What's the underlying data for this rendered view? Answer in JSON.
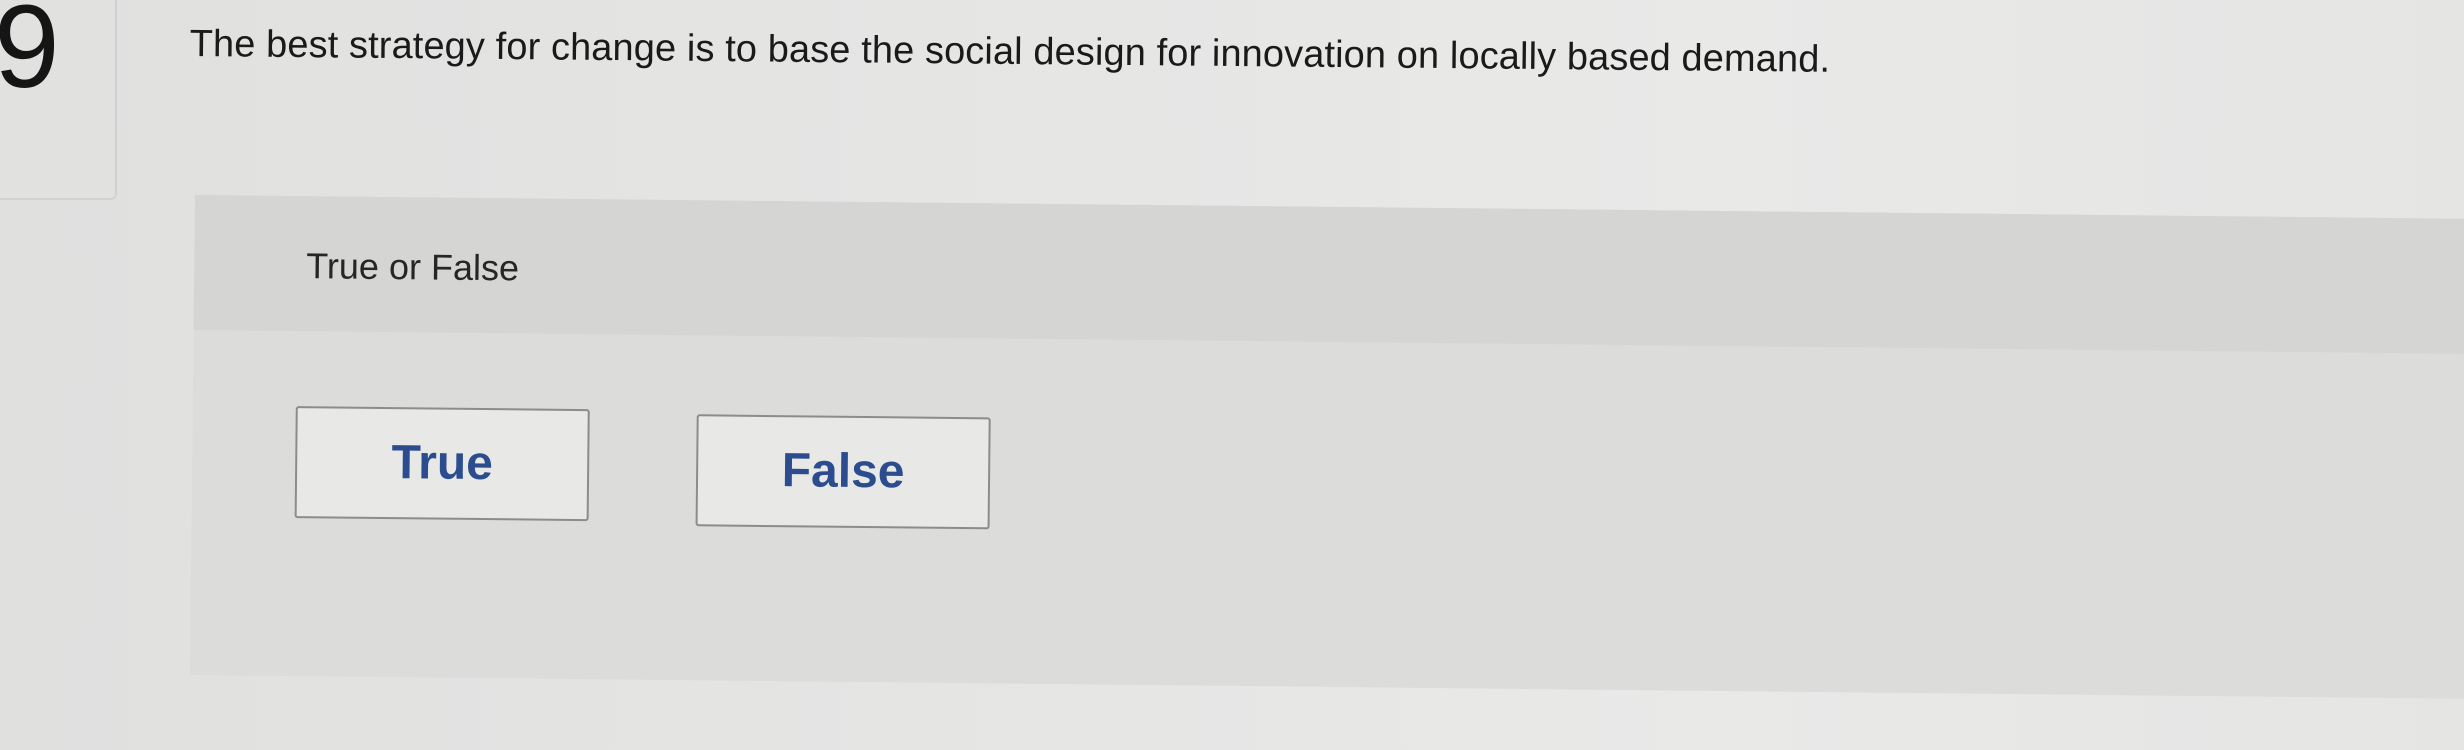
{
  "question": {
    "number": "9",
    "text": "The best strategy for change is to base the social design for innovation on locally based demand."
  },
  "answer_panel": {
    "prompt": "True or False",
    "choices": [
      {
        "label": "True"
      },
      {
        "label": "False"
      }
    ],
    "choice_text_color": "#2b4c8e"
  }
}
